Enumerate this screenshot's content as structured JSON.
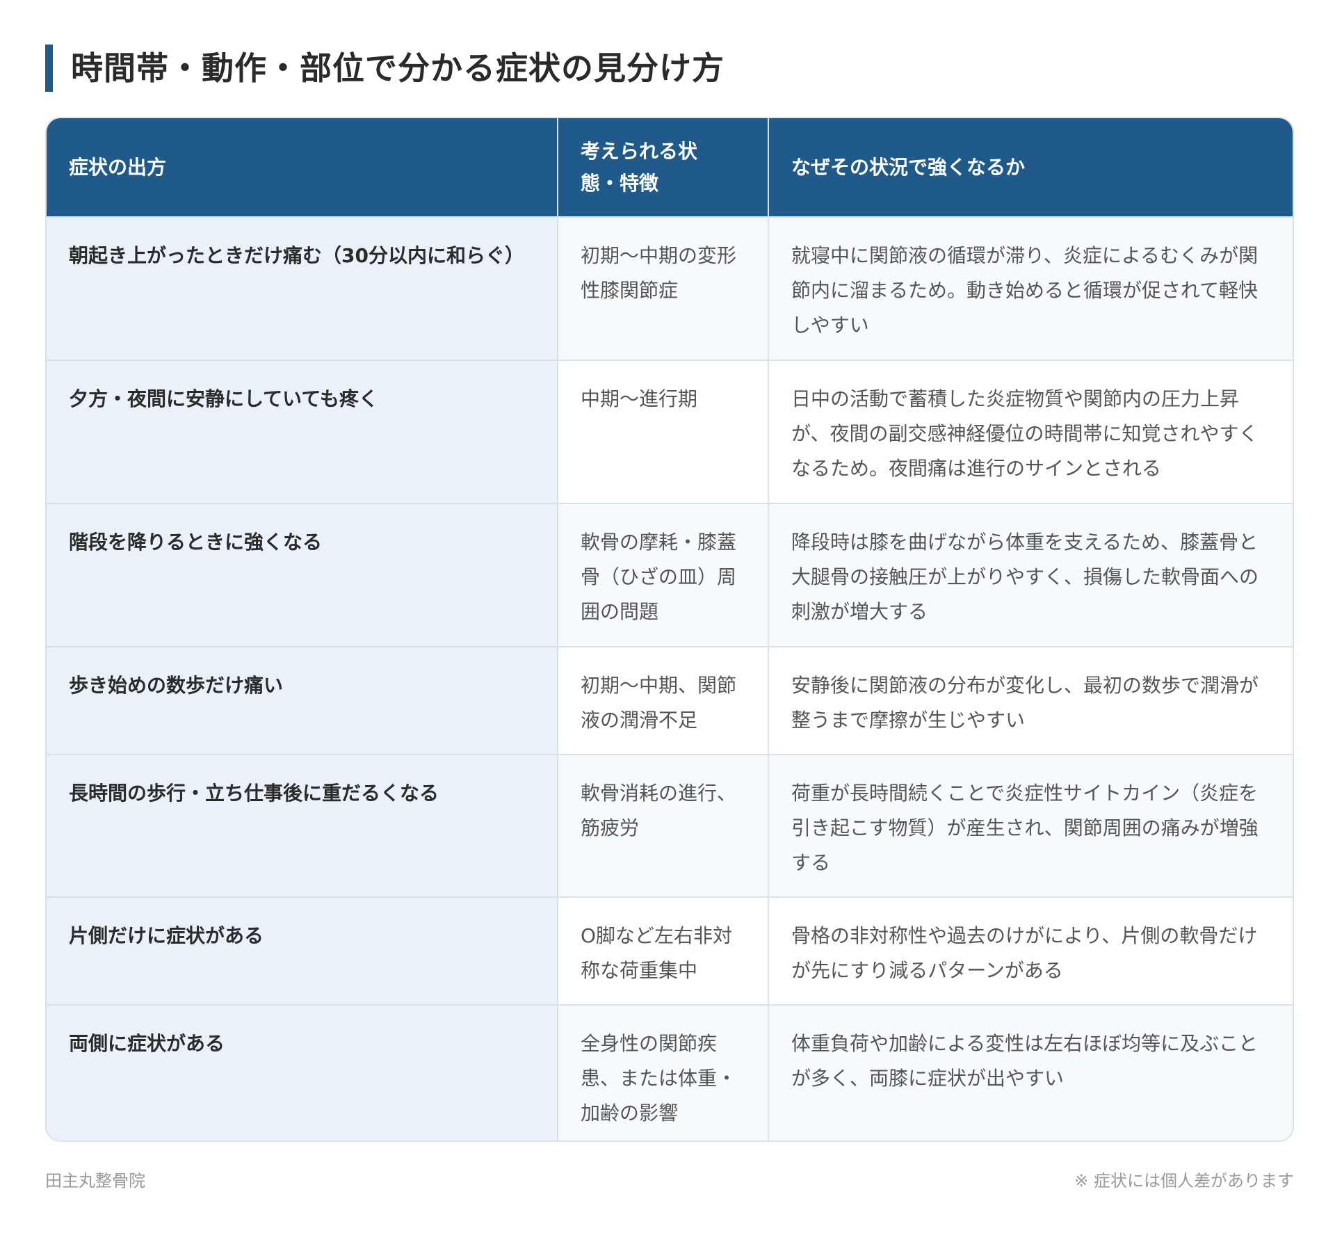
{
  "title": "時間帯・動作・部位で分かる症状の見分け方",
  "table": {
    "headers": {
      "symptom": "症状の出方",
      "state_line1": "考えられる状",
      "state_line2": "態・特徴",
      "reason": "なぜその状況で強くなるか"
    },
    "rows": [
      {
        "symptom": "朝起き上がったときだけ痛む（30分以内に和らぐ）",
        "state": "初期〜中期の変形性膝関節症",
        "reason": "就寝中に関節液の循環が滞り、炎症によるむくみが関節内に溜まるため。動き始めると循環が促されて軽快しやすい"
      },
      {
        "symptom": "夕方・夜間に安静にしていても疼く",
        "state": "中期〜進行期",
        "reason": "日中の活動で蓄積した炎症物質や関節内の圧力上昇が、夜間の副交感神経優位の時間帯に知覚されやすくなるため。夜間痛は進行のサインとされる"
      },
      {
        "symptom": "階段を降りるときに強くなる",
        "state": "軟骨の摩耗・膝蓋骨（ひざの皿）周囲の問題",
        "reason": "降段時は膝を曲げながら体重を支えるため、膝蓋骨と大腿骨の接触圧が上がりやすく、損傷した軟骨面への刺激が増大する"
      },
      {
        "symptom": "歩き始めの数歩だけ痛い",
        "state": "初期〜中期、関節液の潤滑不足",
        "reason": "安静後に関節液の分布が変化し、最初の数歩で潤滑が整うまで摩擦が生じやすい"
      },
      {
        "symptom": "長時間の歩行・立ち仕事後に重だるくなる",
        "state": "軟骨消耗の進行、筋疲労",
        "reason": "荷重が長時間続くことで炎症性サイトカイン（炎症を引き起こす物質）が産生され、関節周囲の痛みが増強する"
      },
      {
        "symptom": "片側だけに症状がある",
        "state": "O脚など左右非対称な荷重集中",
        "reason": "骨格の非対称性や過去のけがにより、片側の軟骨だけが先にすり減るパターンがある"
      },
      {
        "symptom": "両側に症状がある",
        "state": "全身性の関節疾患、または体重・加齢の影響",
        "reason": "体重負荷や加齢による変性は左右ほぼ均等に及ぶことが多く、両膝に症状が出やすい"
      }
    ]
  },
  "footer": {
    "clinic": "田主丸整骨院",
    "note": "※ 症状には個人差があります"
  }
}
